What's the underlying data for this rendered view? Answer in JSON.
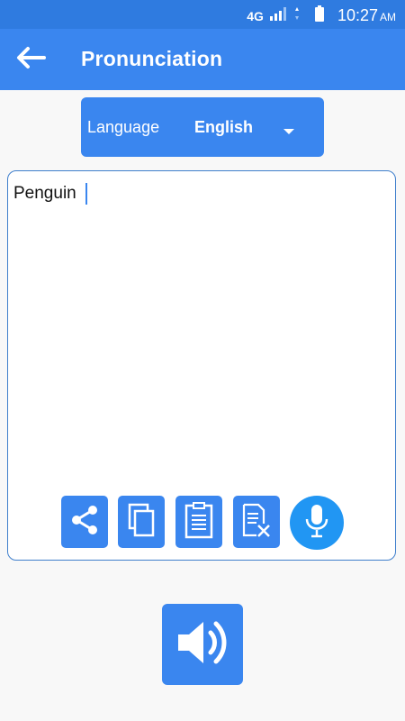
{
  "status_bar": {
    "network": "4G",
    "time": "10:27",
    "ampm": "AM",
    "icons": [
      "signal-icon",
      "battery-icon"
    ]
  },
  "app_bar": {
    "title": "Pronunciation",
    "back_icon": "arrow-left-icon"
  },
  "language": {
    "label": "Language",
    "selected": "English"
  },
  "editor": {
    "text": "Penguin"
  },
  "toolbar": {
    "buttons": [
      "share-icon",
      "copy-icon",
      "paste-icon",
      "clear-text-icon",
      "mic-icon"
    ]
  },
  "speak_button": {
    "icon": "speaker-icon"
  },
  "colors": {
    "primary": "#3a86ef",
    "status_bar": "#2f7be0",
    "mic": "#2196f3",
    "background": "#f8f8f8"
  }
}
